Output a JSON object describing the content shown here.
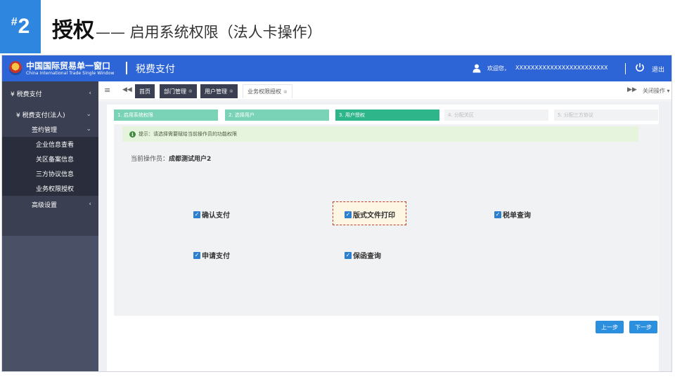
{
  "slide": {
    "number": "2",
    "number_prefix": "#",
    "title": "授权",
    "subtitle": "—— 启用系统权限（法人卡操作）"
  },
  "app": {
    "logo_cn": "中国国际贸易单一窗口",
    "logo_en": "China International Trade Single Window",
    "module": "税费支付",
    "welcome": "欢迎您，",
    "user_id": "XXXXXXXXXXXXXXXXXXXXXXXX",
    "logout": "退出"
  },
  "sidebar": {
    "items": [
      {
        "label": "¥ 税费支付",
        "level": 0,
        "chevron": "‹"
      },
      {
        "label": "¥ 税费支付(法人)",
        "level": 1,
        "chevron": "⌄"
      },
      {
        "label": "签约管理",
        "level": 2,
        "chevron": "⌄"
      },
      {
        "label": "企业信息查看",
        "level": 3
      },
      {
        "label": "关区备案信息",
        "level": 3
      },
      {
        "label": "三方协议信息",
        "level": 3
      },
      {
        "label": "业务权限授权",
        "level": 3
      },
      {
        "label": "高级设置",
        "level": 2,
        "chevron": "‹"
      }
    ]
  },
  "tabs": {
    "menu_icon": "≡",
    "prev_icon": "◀◀",
    "items": [
      {
        "label": "首页",
        "closable": false
      },
      {
        "label": "部门管理",
        "closable": true
      },
      {
        "label": "用户管理",
        "closable": true
      },
      {
        "label": "业务权限授权",
        "closable": true,
        "active": true
      }
    ],
    "next_icon": "▶▶",
    "close_ops": "关闭操作 ▾"
  },
  "steps": [
    {
      "label": "1. 启用系统权限",
      "state": "done"
    },
    {
      "label": "2. 选择用户",
      "state": "done"
    },
    {
      "label": "3. 用户授权",
      "state": "current"
    },
    {
      "label": "4. 分配关区",
      "state": "todo"
    },
    {
      "label": "5. 分配三方协议",
      "state": "todo"
    }
  ],
  "tip": {
    "text": "提示：请选择需要赋给当前操作员的功能权限"
  },
  "operator": {
    "label": "当前操作员：",
    "name": "成都测试用户2"
  },
  "permissions": [
    {
      "label": "确认支付",
      "checked": true
    },
    {
      "label": "版式文件打印",
      "checked": true,
      "highlighted": true
    },
    {
      "label": "税单查询",
      "checked": true
    },
    {
      "label": "申请支付",
      "checked": true
    },
    {
      "label": "保函查询",
      "checked": true
    }
  ],
  "buttons": {
    "prev": "上一步",
    "next": "下一步"
  },
  "colors": {
    "header_blue": "#2d64d6",
    "sidebar": "#3a3f51",
    "step_done": "#7ad3b6",
    "step_current": "#2fb58a",
    "button_blue": "#2b8fe0",
    "highlight_border": "#c0392b"
  }
}
